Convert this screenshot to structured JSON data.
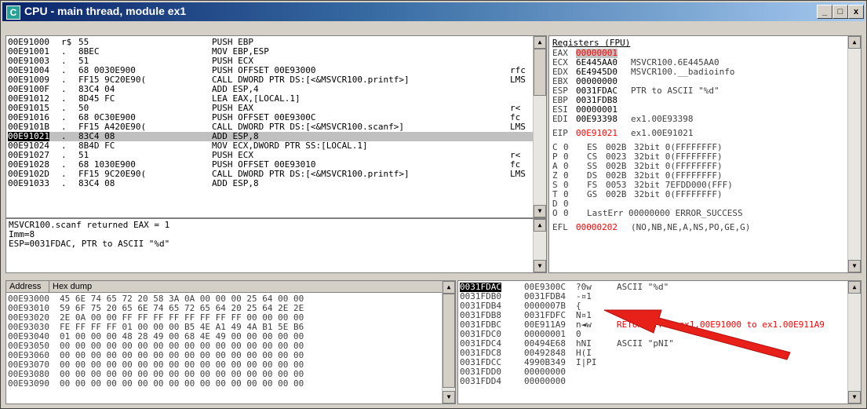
{
  "window": {
    "title": "CPU - main thread, module ex1",
    "app_icon_letter": "C",
    "btn_min": "_",
    "btn_max": "□",
    "btn_close": "x"
  },
  "disasm": {
    "rows": [
      {
        "addr": "00E91000",
        "mark": "r$",
        "hex": "55",
        "instr": "PUSH EBP",
        "side": ""
      },
      {
        "addr": "00E91001",
        "mark": ".",
        "hex": "8BEC",
        "instr": "MOV EBP,ESP",
        "side": ""
      },
      {
        "addr": "00E91003",
        "mark": ".",
        "hex": "51",
        "instr": "PUSH ECX",
        "side": ""
      },
      {
        "addr": "00E91004",
        "mark": ".",
        "hex": "68 0030E900",
        "instr": "PUSH OFFSET 00E93000",
        "side": "rfc"
      },
      {
        "addr": "00E91009",
        "mark": ".",
        "hex": "FF15 9C20E90(",
        "instr": "CALL DWORD PTR DS:[<&MSVCR100.printf>]",
        "side": "LMS"
      },
      {
        "addr": "00E9100F",
        "mark": ".",
        "hex": "83C4 04",
        "instr": "ADD ESP,4",
        "side": ""
      },
      {
        "addr": "00E91012",
        "mark": ".",
        "hex": "8D45 FC",
        "instr": "LEA EAX,[LOCAL.1]",
        "side": ""
      },
      {
        "addr": "00E91015",
        "mark": ".",
        "hex": "50",
        "instr": "PUSH EAX",
        "side": "r<"
      },
      {
        "addr": "00E91016",
        "mark": ".",
        "hex": "68 0C30E900",
        "instr": "PUSH OFFSET 00E9300C",
        "side": "fc"
      },
      {
        "addr": "00E9101B",
        "mark": ".",
        "hex": "FF15 A420E90(",
        "instr": "CALL DWORD PTR DS:[<&MSVCR100.scanf>]",
        "side": "LMS"
      },
      {
        "addr": "00E91021",
        "mark": ".",
        "hex": "83C4 08",
        "instr": "ADD ESP,8",
        "side": ""
      },
      {
        "addr": "00E91024",
        "mark": ".",
        "hex": "8B4D FC",
        "instr": "MOV ECX,DWORD PTR SS:[LOCAL.1]",
        "side": ""
      },
      {
        "addr": "00E91027",
        "mark": ".",
        "hex": "51",
        "instr": "PUSH ECX",
        "side": "r<"
      },
      {
        "addr": "00E91028",
        "mark": ".",
        "hex": "68 1030E900",
        "instr": "PUSH OFFSET 00E93010",
        "side": "fc"
      },
      {
        "addr": "00E9102D",
        "mark": ".",
        "hex": "FF15 9C20E90(",
        "instr": "CALL DWORD PTR DS:[<&MSVCR100.printf>]",
        "side": "LMS"
      },
      {
        "addr": "00E91033",
        "mark": ".",
        "hex": "83C4 08",
        "instr": "ADD ESP,8",
        "side": ""
      }
    ]
  },
  "info": {
    "lines": [
      "MSVCR100.scanf returned EAX = 1",
      "Imm=8",
      "ESP=0031FDAC, PTR to ASCII \"%d\""
    ]
  },
  "registers": {
    "title": "Registers (FPU)",
    "regs": [
      {
        "name": "EAX",
        "val": "00000001",
        "note": "",
        "hl": true
      },
      {
        "name": "ECX",
        "val": "6E445AA0",
        "note": "MSVCR100.6E445AA0",
        "hl": false
      },
      {
        "name": "EDX",
        "val": "6E4945D0",
        "note": "MSVCR100.__badioinfo",
        "hl": false
      },
      {
        "name": "EBX",
        "val": "00000000",
        "note": "",
        "hl": false
      },
      {
        "name": "ESP",
        "val": "0031FDAC",
        "note": "PTR to ASCII \"%d\"",
        "hl": false
      },
      {
        "name": "EBP",
        "val": "0031FDB8",
        "note": "",
        "hl": false
      },
      {
        "name": "ESI",
        "val": "00000001",
        "note": "",
        "hl": false
      },
      {
        "name": "EDI",
        "val": "00E93398",
        "note": "ex1.00E93398",
        "hl": false
      }
    ],
    "eip": {
      "name": "EIP",
      "val": "00E91021",
      "note": "ex1.00E91021"
    },
    "flags": [
      {
        "f": "C",
        "v": "0",
        "seg": "ES",
        "sv": "002B",
        "d": "32bit 0(FFFFFFFF)"
      },
      {
        "f": "P",
        "v": "0",
        "seg": "CS",
        "sv": "0023",
        "d": "32bit 0(FFFFFFFF)"
      },
      {
        "f": "A",
        "v": "0",
        "seg": "SS",
        "sv": "002B",
        "d": "32bit 0(FFFFFFFF)"
      },
      {
        "f": "Z",
        "v": "0",
        "seg": "DS",
        "sv": "002B",
        "d": "32bit 0(FFFFFFFF)"
      },
      {
        "f": "S",
        "v": "0",
        "seg": "FS",
        "sv": "0053",
        "d": "32bit 7EFDD000(FFF)"
      },
      {
        "f": "T",
        "v": "0",
        "seg": "GS",
        "sv": "002B",
        "d": "32bit 0(FFFFFFFF)"
      },
      {
        "f": "D",
        "v": "0",
        "seg": "",
        "sv": "",
        "d": ""
      },
      {
        "f": "O",
        "v": "0",
        "seg": "",
        "sv": "",
        "d": "LastErr 00000000 ERROR_SUCCESS"
      }
    ],
    "efl": {
      "name": "EFL",
      "val": "00000202",
      "note": "(NO,NB,NE,A,NS,PO,GE,G)"
    }
  },
  "dump": {
    "col_address": "Address",
    "col_hex": "Hex dump",
    "rows": [
      {
        "addr": "00E93000",
        "hex": "45 6E 74 65 72 20 58 3A 0A 00 00 00 25 64 00 00"
      },
      {
        "addr": "00E93010",
        "hex": "59 6F 75 20 65 6E 74 65 72 65 64 20 25 64 2E 2E"
      },
      {
        "addr": "00E93020",
        "hex": "2E 0A 00 00 FF FF FF FF FF FF FF FF 00 00 00 00"
      },
      {
        "addr": "00E93030",
        "hex": "FE FF FF FF 01 00 00 00 B5 4E A1 49 4A B1 5E B6"
      },
      {
        "addr": "00E93040",
        "hex": "01 00 00 00 48 28 49 00 68 4E 49 00 00 00 00 00"
      },
      {
        "addr": "00E93050",
        "hex": "00 00 00 00 00 00 00 00 00 00 00 00 00 00 00 00"
      },
      {
        "addr": "00E93060",
        "hex": "00 00 00 00 00 00 00 00 00 00 00 00 00 00 00 00"
      },
      {
        "addr": "00E93070",
        "hex": "00 00 00 00 00 00 00 00 00 00 00 00 00 00 00 00"
      },
      {
        "addr": "00E93080",
        "hex": "00 00 00 00 00 00 00 00 00 00 00 00 00 00 00 00"
      },
      {
        "addr": "00E93090",
        "hex": "00 00 00 00 00 00 00 00 00 00 00 00 00 00 00 00"
      }
    ]
  },
  "stack": {
    "rows": [
      {
        "addr": "0031FDAC",
        "val": "00E9300C",
        "asc": "?0w",
        "cmt": "ASCII \"%d\"",
        "top": true
      },
      {
        "addr": "0031FDB0",
        "val": "0031FDB4",
        "asc": "-¤1",
        "cmt": "",
        "top": false
      },
      {
        "addr": "0031FDB4",
        "val": "0000007B",
        "asc": "{",
        "cmt": "",
        "top": false
      },
      {
        "addr": "0031FDB8",
        "val": "0031FDFC",
        "asc": "N¤1",
        "cmt": "",
        "top": false
      },
      {
        "addr": "0031FDBC",
        "val": "00E911A9",
        "asc": "n◄w",
        "cmt": "RETURN from ex1.00E91000 to ex1.00E911A9",
        "top": false
      },
      {
        "addr": "0031FDC0",
        "val": "00000001",
        "asc": "0",
        "cmt": "",
        "top": false
      },
      {
        "addr": "0031FDC4",
        "val": "00494E68",
        "asc": "hNI",
        "cmt": "ASCII \"pNI\"",
        "top": false
      },
      {
        "addr": "0031FDC8",
        "val": "00492848",
        "asc": "H(I",
        "cmt": "",
        "top": false
      },
      {
        "addr": "0031FDCC",
        "val": "4990B349",
        "asc": "I|PI",
        "cmt": "",
        "top": false
      },
      {
        "addr": "0031FDD0",
        "val": "00000000",
        "asc": "",
        "cmt": "",
        "top": false
      },
      {
        "addr": "0031FDD4",
        "val": "00000000",
        "asc": "",
        "cmt": "",
        "top": false
      }
    ]
  },
  "colors": {
    "title_start": "#0a246a",
    "title_end": "#a6caf0",
    "highlight": "#ff0000",
    "arrow": "#e8201a"
  }
}
